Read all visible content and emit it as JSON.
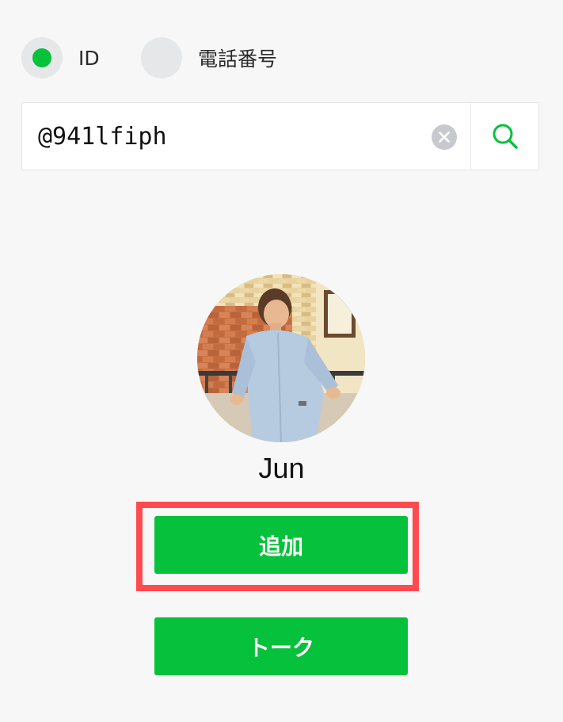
{
  "search_type": {
    "options": [
      {
        "label": "ID",
        "selected": true
      },
      {
        "label": "電話番号",
        "selected": false
      }
    ]
  },
  "search": {
    "value": "@941lfiph",
    "placeholder": ""
  },
  "icons": {
    "clear": "clear-circle-x-icon",
    "search": "magnifier-search-icon"
  },
  "profile": {
    "name": "Jun",
    "avatar": "profile-photo"
  },
  "actions": {
    "add_label": "追加",
    "talk_label": "トーク"
  },
  "colors": {
    "accent": "#06c13b",
    "highlight": "#ff4b4f",
    "background": "#f7f7f7",
    "radio_idle": "#e6e7e9"
  }
}
